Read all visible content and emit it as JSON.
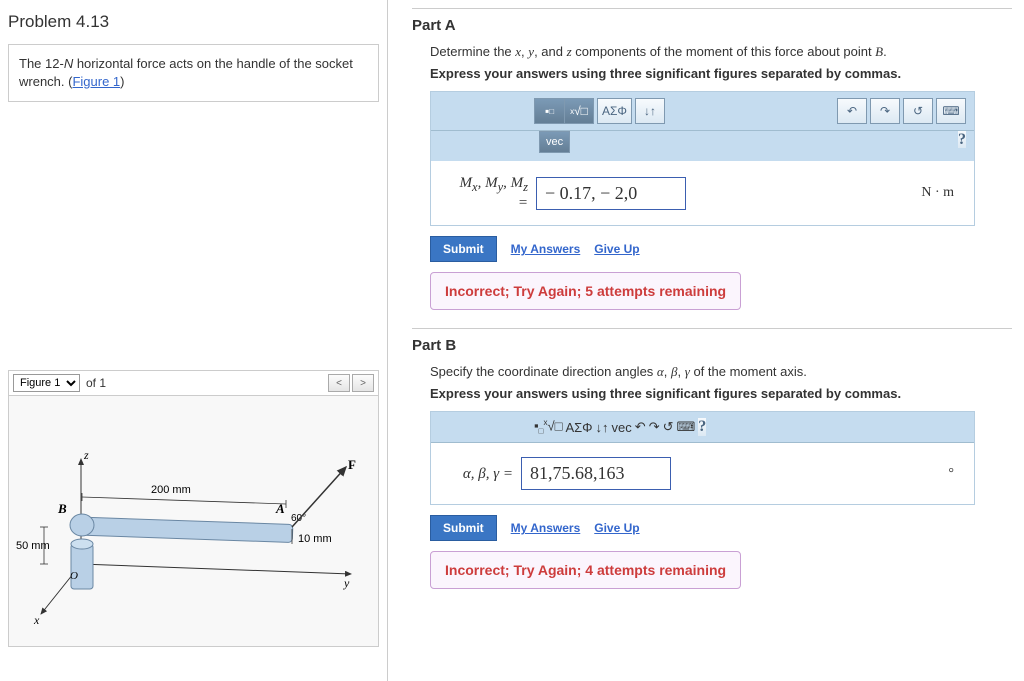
{
  "problem": {
    "title": "Problem 4.13",
    "desc_prefix": "The 12-",
    "desc_unit": "N",
    "desc_suffix": " horizontal force acts on the handle of the socket wrench. (",
    "figure_link": "Figure 1",
    "desc_close": ")"
  },
  "figure": {
    "selector": "Figure 1",
    "of_label": "of 1",
    "dim_200": "200 mm",
    "dim_10": "10 mm",
    "dim_50": "50 mm",
    "angle": "60°",
    "label_A": "A",
    "label_B": "B",
    "label_F": "F",
    "axis_x": "x",
    "axis_y": "y",
    "axis_z": "z",
    "label_O": "O"
  },
  "partA": {
    "title": "Part A",
    "desc_1": "Determine the ",
    "var_x": "x",
    "var_y": "y",
    "var_z": "z",
    "desc_2": ", ",
    "desc_3": ", and ",
    "desc_4": " components of the moment of this force about point ",
    "var_B": "B",
    "desc_5": ".",
    "instruct": "Express your answers using three significant figures separated by commas.",
    "tool_sigma": "ΑΣΦ",
    "tool_vec": "vec",
    "tool_help": "?",
    "input_label": "Mₓ, Mᵧ, M_z =",
    "input_value": "− 0.17, − 2,0",
    "unit": "N · m",
    "submit": "Submit",
    "my_answers": "My Answers",
    "give_up": "Give Up",
    "feedback": "Incorrect; Try Again; 5 attempts remaining"
  },
  "partB": {
    "title": "Part B",
    "desc_1": "Specify the coordinate direction angles ",
    "var_a": "α",
    "var_b": "β",
    "var_g": "γ",
    "desc_2": ", ",
    "desc_3": ", ",
    "desc_4": " of the moment axis.",
    "instruct": "Express your answers using three significant figures separated by commas.",
    "tool_sigma": "ΑΣΦ",
    "tool_vec": "vec",
    "tool_help": "?",
    "input_label": "α, β, γ = ",
    "input_value": "81,75.68,163",
    "unit": "°",
    "submit": "Submit",
    "my_answers": "My Answers",
    "give_up": "Give Up",
    "feedback": "Incorrect; Try Again; 4 attempts remaining"
  }
}
